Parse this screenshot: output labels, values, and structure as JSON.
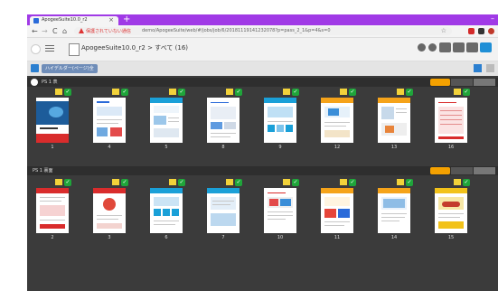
{
  "tab": {
    "title": "ApogeeSuite10.0_r2",
    "close": "×"
  },
  "newtab": "+",
  "window_minimize": "–",
  "address": {
    "warning": "保護されていない通信",
    "url": "demo/ApogeeSuite/web/#/jobs/job/6/20181119141232078?p=pass_2_1&p=4&s=0"
  },
  "nav": {
    "back": "←",
    "forward": "→",
    "reload": "C",
    "home": "⌂"
  },
  "app": {
    "title": "ApogeeSuite10.0_r2 > すべて (16)"
  },
  "chip": "ハイデルダー(ページ)全",
  "icon_colors": {
    "accent": "#1f8fd6",
    "tab_strip": "#a03ae6",
    "note": "#f2d23a",
    "check": "#1fa53a",
    "section_flag": "#f4a100"
  },
  "sections": [
    {
      "label": "PS 1   表",
      "pages": [
        {
          "num": "1",
          "style": "cover"
        },
        {
          "num": "4",
          "style": "blueband"
        },
        {
          "num": "5",
          "style": "blueband"
        },
        {
          "num": "8",
          "style": "table"
        },
        {
          "num": "9",
          "style": "blueband"
        },
        {
          "num": "12",
          "style": "orange"
        },
        {
          "num": "13",
          "style": "orange"
        },
        {
          "num": "16",
          "style": "redtable"
        }
      ]
    },
    {
      "label": "PS 1   裏面",
      "pages": [
        {
          "num": "2",
          "style": "red"
        },
        {
          "num": "3",
          "style": "redcircle"
        },
        {
          "num": "6",
          "style": "blueband"
        },
        {
          "num": "7",
          "style": "blueband"
        },
        {
          "num": "10",
          "style": "table"
        },
        {
          "num": "11",
          "style": "orange"
        },
        {
          "num": "14",
          "style": "orange"
        },
        {
          "num": "15",
          "style": "yellowcar"
        }
      ]
    }
  ]
}
